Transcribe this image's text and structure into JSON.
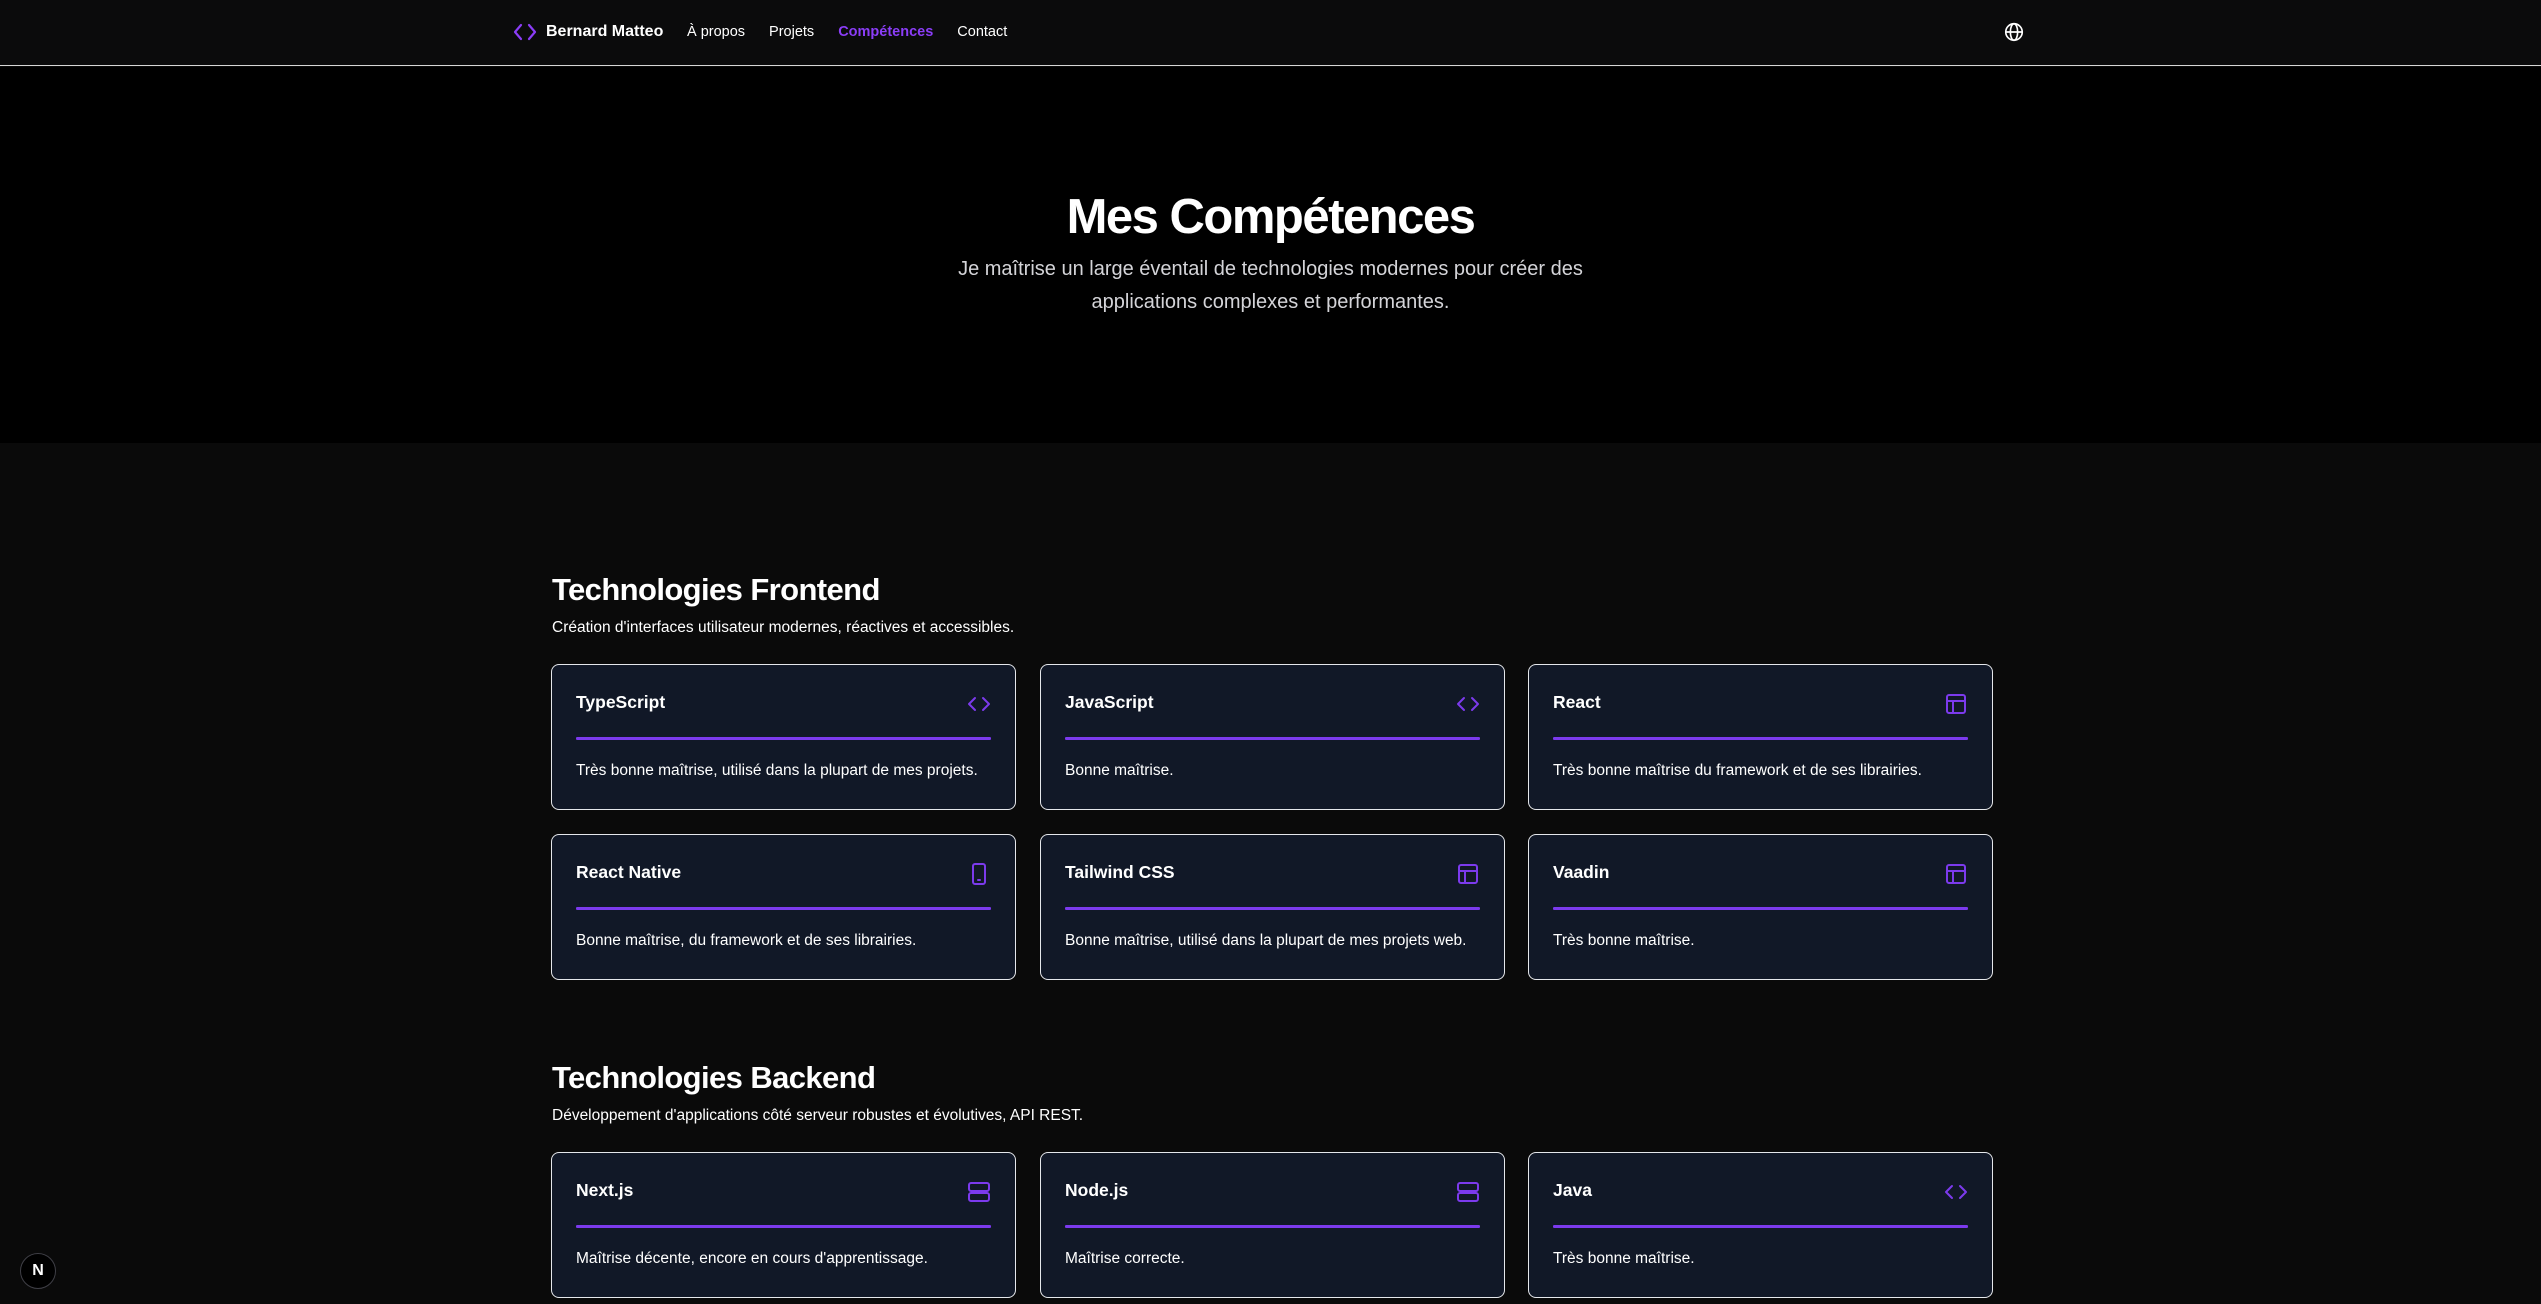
{
  "nav": {
    "brand": "Bernard Matteo",
    "brand_icon": "code-brackets-icon",
    "links": [
      "À propos",
      "Projets",
      "Compétences",
      "Contact"
    ],
    "active_link": "Compétences",
    "language_icon": "globe-icon"
  },
  "hero": {
    "title": "Mes Compétences",
    "subtitle": "Je maîtrise un large éventail de technologies modernes pour créer des applications complexes et performantes."
  },
  "sections": [
    {
      "title": "Technologies Frontend",
      "description": "Création d'interfaces utilisateur modernes, réactives et accessibles.",
      "skills": [
        {
          "name": "TypeScript",
          "icon": "code-icon",
          "level": 1.0,
          "description": "Très bonne maîtrise, utilisé dans la plupart de mes projets."
        },
        {
          "name": "JavaScript",
          "icon": "code-icon",
          "level": 1.0,
          "description": "Bonne maîtrise."
        },
        {
          "name": "React",
          "icon": "layout-icon",
          "level": 1.0,
          "description": "Très bonne maîtrise du framework et de ses librairies."
        },
        {
          "name": "React Native",
          "icon": "smartphone-icon",
          "level": 1.0,
          "description": "Bonne maîtrise, du framework et de ses librairies."
        },
        {
          "name": "Tailwind CSS",
          "icon": "layout-icon",
          "level": 1.0,
          "description": "Bonne maîtrise, utilisé dans la plupart de mes projets web."
        },
        {
          "name": "Vaadin",
          "icon": "layout-icon",
          "level": 1.0,
          "description": "Très bonne maîtrise."
        }
      ]
    },
    {
      "title": "Technologies Backend",
      "description": "Développement d'applications côté serveur robustes et évolutives, API REST.",
      "skills": [
        {
          "name": "Next.js",
          "icon": "server-icon",
          "level": 1.0,
          "description": "Maîtrise décente, encore en cours d'apprentissage."
        },
        {
          "name": "Node.js",
          "icon": "server-icon",
          "level": 1.0,
          "description": "Maîtrise correcte."
        },
        {
          "name": "Java",
          "icon": "code-icon",
          "level": 1.0,
          "description": "Très bonne maîtrise."
        }
      ]
    }
  ],
  "dev_badge": "N",
  "colors": {
    "accent": "#7c3aed",
    "card_bg": "#111827",
    "page_bg": "#0a0a0a",
    "hero_bg": "#000000"
  }
}
